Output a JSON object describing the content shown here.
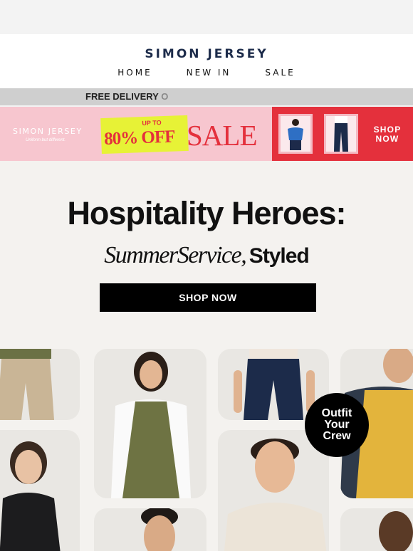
{
  "header": {
    "brand": "SIMON JERSEY",
    "nav": [
      "HOME",
      "NEW IN",
      "SALE"
    ]
  },
  "ticker": {
    "text": "FREE DELIVERY",
    "trailing_char": "O"
  },
  "banner": {
    "logo": "SIMON JERSEY",
    "tagline": "Uniform but different.",
    "sticker_top": "UP TO",
    "sticker_main": "80% OFF",
    "sale_word": "SALE",
    "cta_line1": "SHOP",
    "cta_line2": "NOW",
    "colors": {
      "pink": "#f7c6cf",
      "red": "#e4303c",
      "yellow": "#e7f236"
    }
  },
  "hero": {
    "title": "Hospitality Heroes:",
    "subtitle_script": "SummerService,",
    "subtitle_plain": "Styled",
    "cta": "SHOP NOW",
    "badge": [
      "Outfit",
      "Your",
      "Crew"
    ]
  },
  "colors": {
    "brand_navy": "#1c2b4a",
    "background": "#f4f2ef",
    "tile": "#e9e7e3",
    "apron_olive": "#6e7343",
    "apron_mustard": "#e3b43c"
  }
}
